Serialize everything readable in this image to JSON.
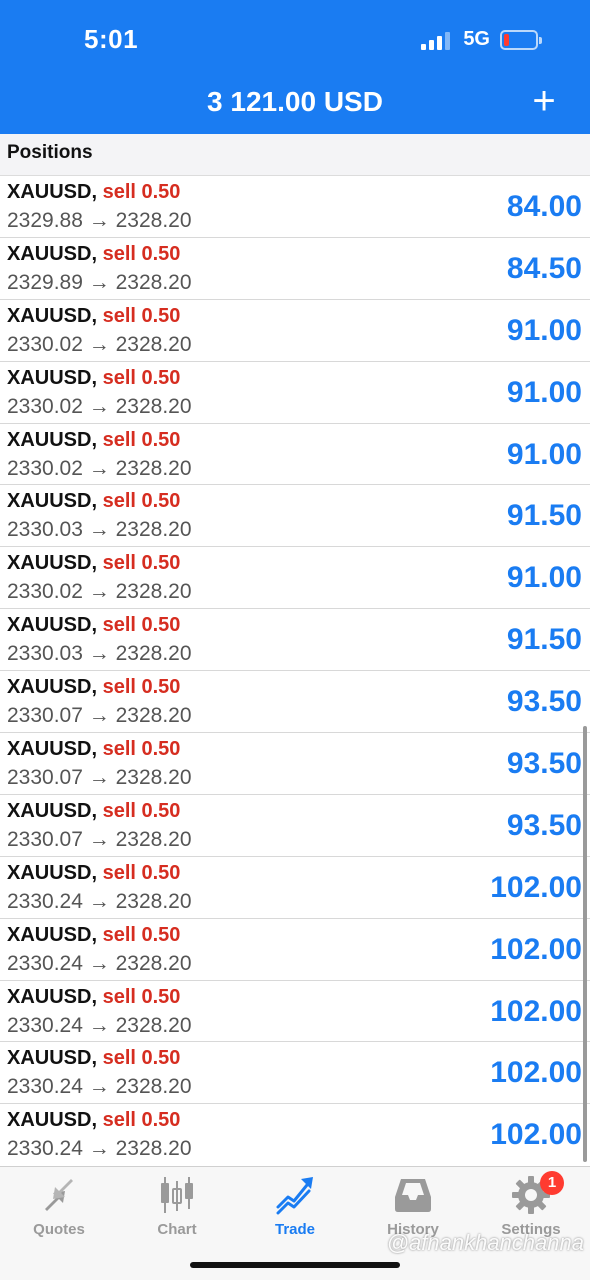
{
  "status_bar": {
    "time": "5:01",
    "network": "5G"
  },
  "header": {
    "balance": "3 121.00 USD",
    "add_label": "+"
  },
  "section": {
    "title": "Positions"
  },
  "positions": [
    {
      "symbol": "XAUUSD,",
      "side": "sell 0.50",
      "open": "2329.88",
      "arrow": "→",
      "current": "2328.20",
      "profit": "84.00"
    },
    {
      "symbol": "XAUUSD,",
      "side": "sell 0.50",
      "open": "2329.89",
      "arrow": "→",
      "current": "2328.20",
      "profit": "84.50"
    },
    {
      "symbol": "XAUUSD,",
      "side": "sell 0.50",
      "open": "2330.02",
      "arrow": "→",
      "current": "2328.20",
      "profit": "91.00"
    },
    {
      "symbol": "XAUUSD,",
      "side": "sell 0.50",
      "open": "2330.02",
      "arrow": "→",
      "current": "2328.20",
      "profit": "91.00"
    },
    {
      "symbol": "XAUUSD,",
      "side": "sell 0.50",
      "open": "2330.02",
      "arrow": "→",
      "current": "2328.20",
      "profit": "91.00"
    },
    {
      "symbol": "XAUUSD,",
      "side": "sell 0.50",
      "open": "2330.03",
      "arrow": "→",
      "current": "2328.20",
      "profit": "91.50"
    },
    {
      "symbol": "XAUUSD,",
      "side": "sell 0.50",
      "open": "2330.02",
      "arrow": "→",
      "current": "2328.20",
      "profit": "91.00"
    },
    {
      "symbol": "XAUUSD,",
      "side": "sell 0.50",
      "open": "2330.03",
      "arrow": "→",
      "current": "2328.20",
      "profit": "91.50"
    },
    {
      "symbol": "XAUUSD,",
      "side": "sell 0.50",
      "open": "2330.07",
      "arrow": "→",
      "current": "2328.20",
      "profit": "93.50"
    },
    {
      "symbol": "XAUUSD,",
      "side": "sell 0.50",
      "open": "2330.07",
      "arrow": "→",
      "current": "2328.20",
      "profit": "93.50"
    },
    {
      "symbol": "XAUUSD,",
      "side": "sell 0.50",
      "open": "2330.07",
      "arrow": "→",
      "current": "2328.20",
      "profit": "93.50"
    },
    {
      "symbol": "XAUUSD,",
      "side": "sell 0.50",
      "open": "2330.24",
      "arrow": "→",
      "current": "2328.20",
      "profit": "102.00"
    },
    {
      "symbol": "XAUUSD,",
      "side": "sell 0.50",
      "open": "2330.24",
      "arrow": "→",
      "current": "2328.20",
      "profit": "102.00"
    },
    {
      "symbol": "XAUUSD,",
      "side": "sell 0.50",
      "open": "2330.24",
      "arrow": "→",
      "current": "2328.20",
      "profit": "102.00"
    },
    {
      "symbol": "XAUUSD,",
      "side": "sell 0.50",
      "open": "2330.24",
      "arrow": "→",
      "current": "2328.20",
      "profit": "102.00"
    },
    {
      "symbol": "XAUUSD,",
      "side": "sell 0.50",
      "open": "2330.24",
      "arrow": "→",
      "current": "2328.20",
      "profit": "102.00"
    }
  ],
  "tabbar": {
    "tabs": [
      {
        "label": "Quotes",
        "icon": "quotes-arrows-icon"
      },
      {
        "label": "Chart",
        "icon": "candlestick-icon"
      },
      {
        "label": "Trade",
        "icon": "trend-line-icon"
      },
      {
        "label": "History",
        "icon": "inbox-tray-icon"
      },
      {
        "label": "Settings",
        "icon": "gear-icon"
      }
    ],
    "settings_badge": "1",
    "active": "Trade"
  },
  "watermark": "@afnankhanchanna",
  "colors": {
    "accent": "#1a7cf2",
    "sell": "#d62d20",
    "badge": "#ff3b30"
  }
}
